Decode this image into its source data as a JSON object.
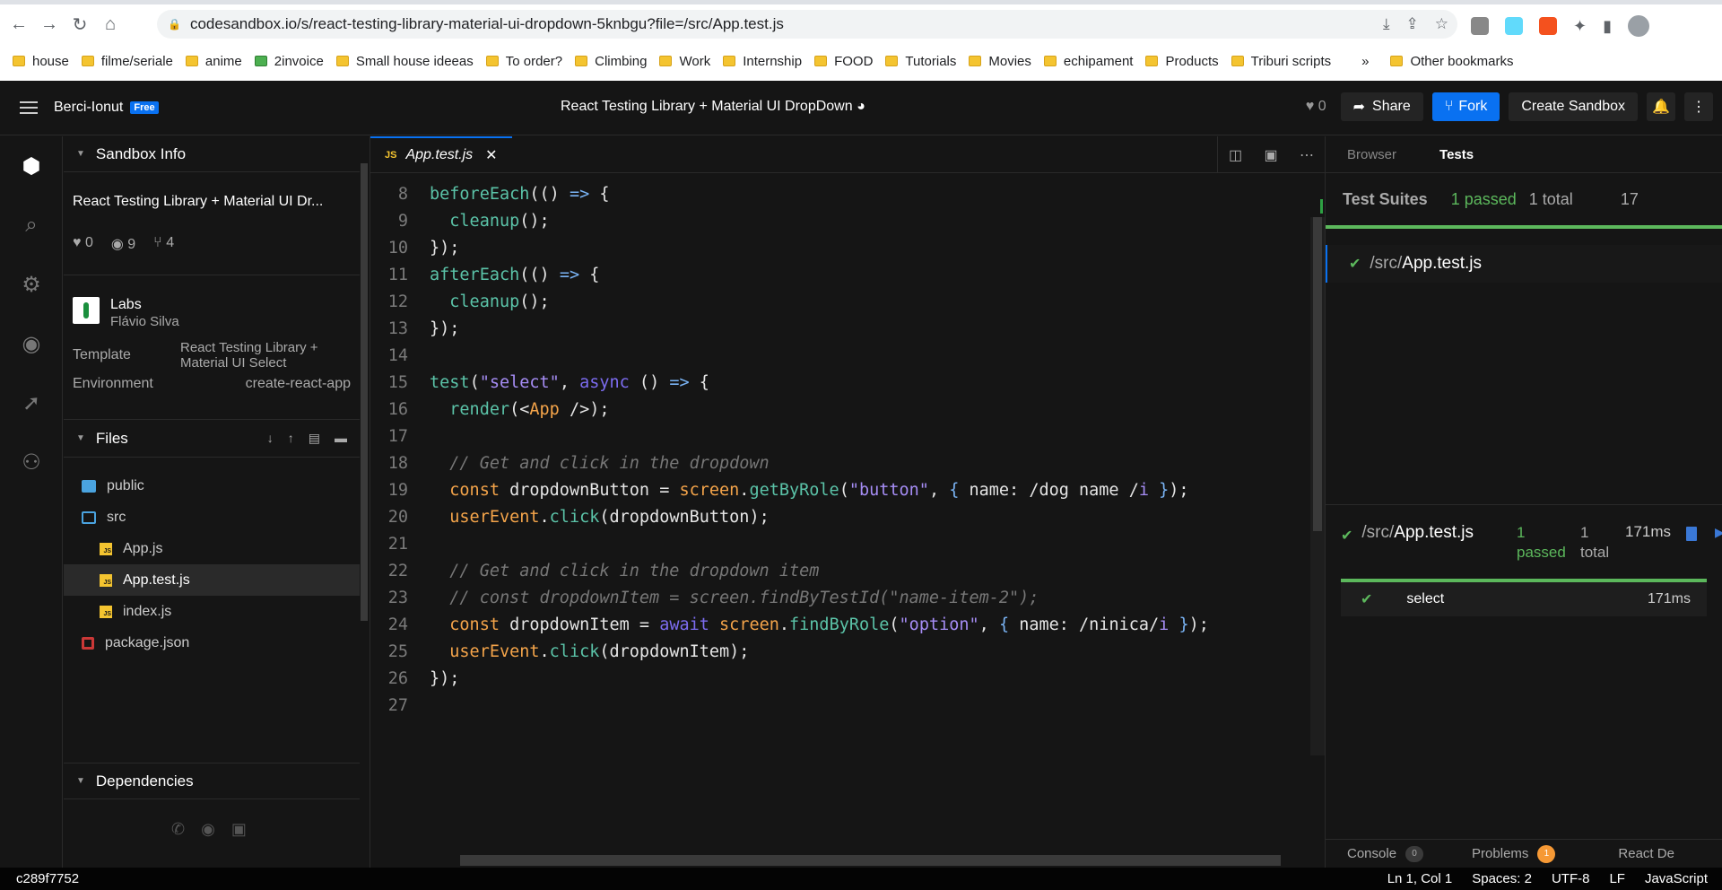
{
  "browser": {
    "url": "codesandbox.io/s/react-testing-library-material-ui-dropdown-5knbgu?file=/src/App.test.js",
    "bookmarks": [
      "house",
      "filme/seriale",
      "anime",
      "2invoice",
      "Small house ideeas",
      "To order?",
      "Climbing",
      "Work",
      "Internship",
      "FOOD",
      "Tutorials",
      "Movies",
      "echipament",
      "Products",
      "Triburi scripts"
    ],
    "more": "»",
    "other_bookmarks": "Other bookmarks"
  },
  "header": {
    "user": "Berci-Ionut",
    "badge": "Free",
    "title": "React Testing Library + Material UI DropDown",
    "likes": "0",
    "share": "Share",
    "fork": "Fork",
    "create": "Create Sandbox"
  },
  "sidebar": {
    "info_title": "Sandbox Info",
    "sandbox_name": "React Testing Library + Material UI Dr...",
    "stats": {
      "likes": "0",
      "views": "9",
      "forks": "4"
    },
    "team": "Labs",
    "author": "Flávio Silva",
    "template_label": "Template",
    "template_value": "React Testing Library + Material UI Select",
    "env_label": "Environment",
    "env_value": "create-react-app",
    "files_title": "Files",
    "files": [
      {
        "name": "public",
        "type": "folder"
      },
      {
        "name": "src",
        "type": "folder-open"
      },
      {
        "name": "App.js",
        "type": "js"
      },
      {
        "name": "App.test.js",
        "type": "js",
        "selected": true
      },
      {
        "name": "index.js",
        "type": "js"
      },
      {
        "name": "package.json",
        "type": "npm"
      }
    ],
    "deps_title": "Dependencies"
  },
  "editor": {
    "tab_label": "App.test.js",
    "tab_icon": "JS",
    "line_numbers": [
      "8",
      "9",
      "10",
      "11",
      "12",
      "13",
      "14",
      "15",
      "16",
      "17",
      "18",
      "19",
      "20",
      "21",
      "22",
      "23",
      "24",
      "25",
      "26",
      "27"
    ]
  },
  "tests": {
    "tab_browser": "Browser",
    "tab_tests": "Tests",
    "suites_label": "Test Suites",
    "passed": "1 passed",
    "total": "1 total",
    "time_short": "17",
    "suite_dir": "/src/",
    "suite_file": "App.test.js",
    "detail_passed_1": "1",
    "detail_passed_2": "passed",
    "detail_total_1": "1",
    "detail_total_2": "total",
    "detail_time": "171ms",
    "test_name": "select",
    "test_time": "171ms",
    "console": "Console",
    "console_count": "0",
    "problems": "Problems",
    "problems_count": "1",
    "react_dev": "React De"
  },
  "status": {
    "commit": "c289f7752",
    "position": "Ln 1, Col 1",
    "spaces": "Spaces: 2",
    "encoding": "UTF-8",
    "eol": "LF",
    "language": "JavaScript"
  }
}
